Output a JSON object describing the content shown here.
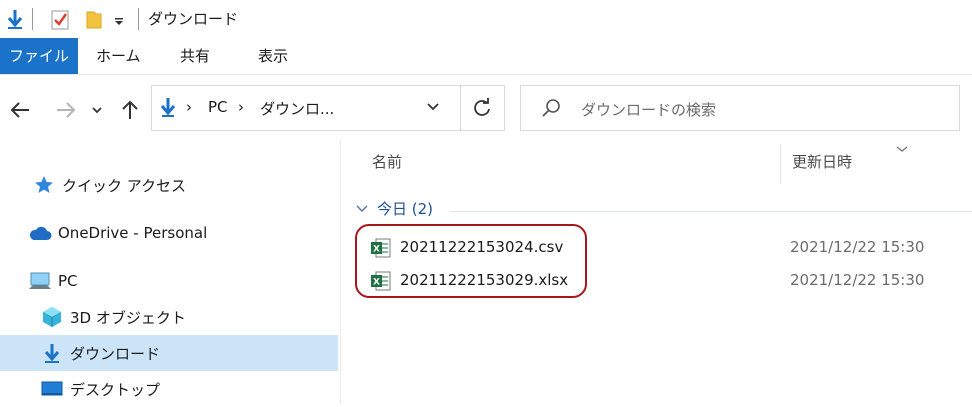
{
  "window": {
    "title": "ダウンロード"
  },
  "ribbon": {
    "tabs": [
      "ファイル",
      "ホーム",
      "共有",
      "表示"
    ]
  },
  "address": {
    "crumbs": [
      "PC",
      "ダウンロ..."
    ]
  },
  "search": {
    "placeholder": "ダウンロードの検索"
  },
  "nav": {
    "items": [
      {
        "label": "クイック アクセス"
      },
      {
        "label": "OneDrive - Personal"
      },
      {
        "label": "PC"
      },
      {
        "label": "3D オブジェクト"
      },
      {
        "label": "ダウンロード"
      },
      {
        "label": "デスクトップ"
      }
    ]
  },
  "list": {
    "columns": [
      "名前",
      "更新日時"
    ],
    "group": "今日 (2)",
    "files": [
      {
        "name": "20211222153024.csv",
        "modified": "2021/12/22 15:30"
      },
      {
        "name": "20211222153029.xlsx",
        "modified": "2021/12/22 15:30"
      }
    ]
  },
  "colors": {
    "accent": "#1a73c9",
    "highlight_border": "#a8161c",
    "selection": "#cce4f7",
    "excel_green": "#1e7145"
  }
}
